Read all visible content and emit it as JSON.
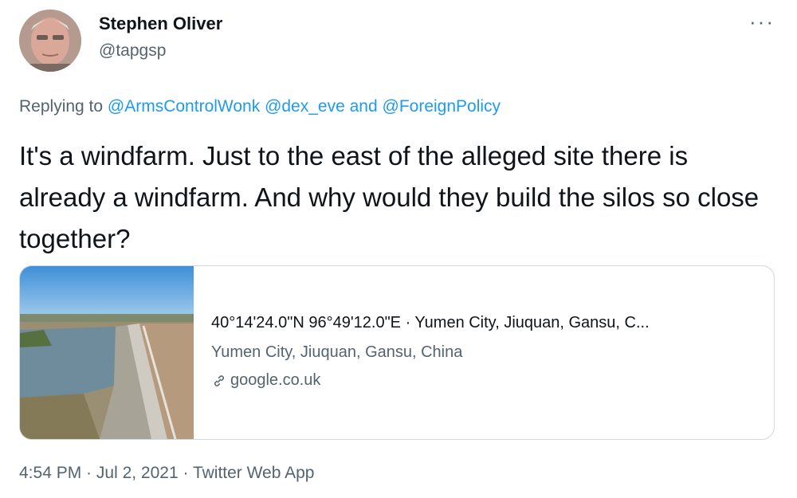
{
  "tweet": {
    "author": {
      "name": "Stephen Oliver",
      "handle": "@tapgsp"
    },
    "more_label": "···",
    "replying": {
      "prefix": "Replying to ",
      "mention_1": "@ArmsControlWonk",
      "mention_2": "@dex_eve",
      "conjunction": " and ",
      "mention_3": "@ForeignPolicy"
    },
    "text": "It's a windfarm. Just to the east of the alleged site there is already a windfarm. And why would they build the silos so close together?",
    "card": {
      "title": "40°14'24.0\"N 96°49'12.0\"E · Yumen City, Jiuquan, Gansu, C...",
      "description": "Yumen City, Jiuquan, Gansu, China",
      "domain": "google.co.uk"
    },
    "meta": {
      "time": "4:54 PM",
      "sep": " · ",
      "date": "Jul 2, 2021",
      "source": "Twitter Web App"
    }
  }
}
